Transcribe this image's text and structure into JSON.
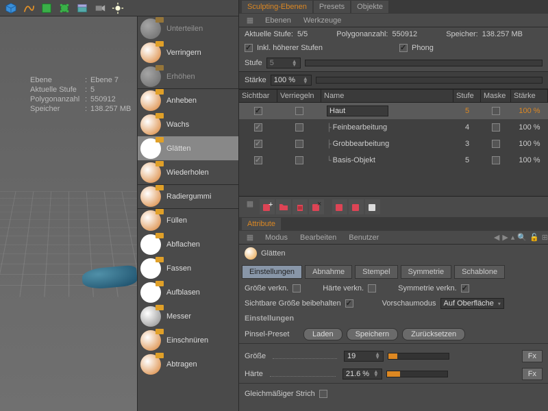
{
  "info": {
    "ebene_label": "Ebene",
    "ebene_value": "Ebene 7",
    "stufe_label": "Aktuelle Stufe",
    "stufe_value": "5",
    "poly_label": "Polygonanzahl",
    "poly_value": "550912",
    "speicher_label": "Speicher",
    "speicher_value": "138.257 MB"
  },
  "tools": [
    {
      "label": "Unterteilen",
      "disabled": true
    },
    {
      "label": "Verringern"
    },
    {
      "label": "Erhöhen",
      "disabled": true
    },
    {
      "label": "Anheben",
      "sep": true
    },
    {
      "label": "Wachs"
    },
    {
      "label": "Glätten",
      "selected": true
    },
    {
      "label": "Wiederholen"
    },
    {
      "label": "Radiergummi",
      "sep": true
    },
    {
      "label": "Füllen",
      "sep": true
    },
    {
      "label": "Abflachen"
    },
    {
      "label": "Fassen"
    },
    {
      "label": "Aufblasen"
    },
    {
      "label": "Messer"
    },
    {
      "label": "Einschnüren"
    },
    {
      "label": "Abtragen"
    }
  ],
  "top_tabs": {
    "t0": "Sculpting-Ebenen",
    "t1": "Presets",
    "t2": "Objekte"
  },
  "sub_tabs": {
    "t0": "Ebenen",
    "t1": "Werkzeuge"
  },
  "status": {
    "stufe_label": "Aktuelle Stufe:",
    "stufe_value": "5/5",
    "poly_label": "Polygonanzahl:",
    "poly_value": "550912",
    "speicher_label": "Speicher:",
    "speicher_value": "138.257 MB",
    "inkl_label": "Inkl. höherer Stufen",
    "phong_label": "Phong",
    "stufe2_label": "Stufe",
    "stufe2_value": "5",
    "staerke_label": "Stärke",
    "staerke_value": "100 %"
  },
  "layer_headers": {
    "vis": "Sichtbar",
    "lock": "Verriegeln",
    "name": "Name",
    "stufe": "Stufe",
    "maske": "Maske",
    "staerke": "Stärke"
  },
  "layers": [
    {
      "name": "Haut",
      "stufe": "5",
      "staerke": "100 %",
      "active": true,
      "editing": true
    },
    {
      "name": "Feinbearbeitung",
      "stufe": "4",
      "staerke": "100 %",
      "tree": "├"
    },
    {
      "name": "Grobbearbeitung",
      "stufe": "3",
      "staerke": "100 %",
      "tree": "├"
    },
    {
      "name": "Basis-Objekt",
      "stufe": "5",
      "staerke": "100 %",
      "tree": "└"
    }
  ],
  "attr_header": "Attribute",
  "attr_subtabs": {
    "t0": "Modus",
    "t1": "Bearbeiten",
    "t2": "Benutzer"
  },
  "brush_name": "Glätten",
  "attr_tabs": {
    "t0": "Einstellungen",
    "t1": "Abnahme",
    "t2": "Stempel",
    "t3": "Symmetrie",
    "t4": "Schablone"
  },
  "props": {
    "groesse_verkn": "Größe verkn.",
    "haerte_verkn": "Härte verkn.",
    "sym_verkn": "Symmetrie verkn.",
    "sichtbare": "Sichtbare Größe beibehalten",
    "vorschau_label": "Vorschaumodus",
    "vorschau_value": "Auf Oberfläche"
  },
  "settings_label": "Einstellungen",
  "preset": {
    "label": "Pinsel-Preset",
    "load": "Laden",
    "save": "Speichern",
    "reset": "Zurücksetzen"
  },
  "size": {
    "label": "Größe",
    "value": "19"
  },
  "hardness": {
    "label": "Härte",
    "value": "21.6 %"
  },
  "stroke": {
    "label": "Gleichmäßiger Strich"
  },
  "fx": "Fx"
}
